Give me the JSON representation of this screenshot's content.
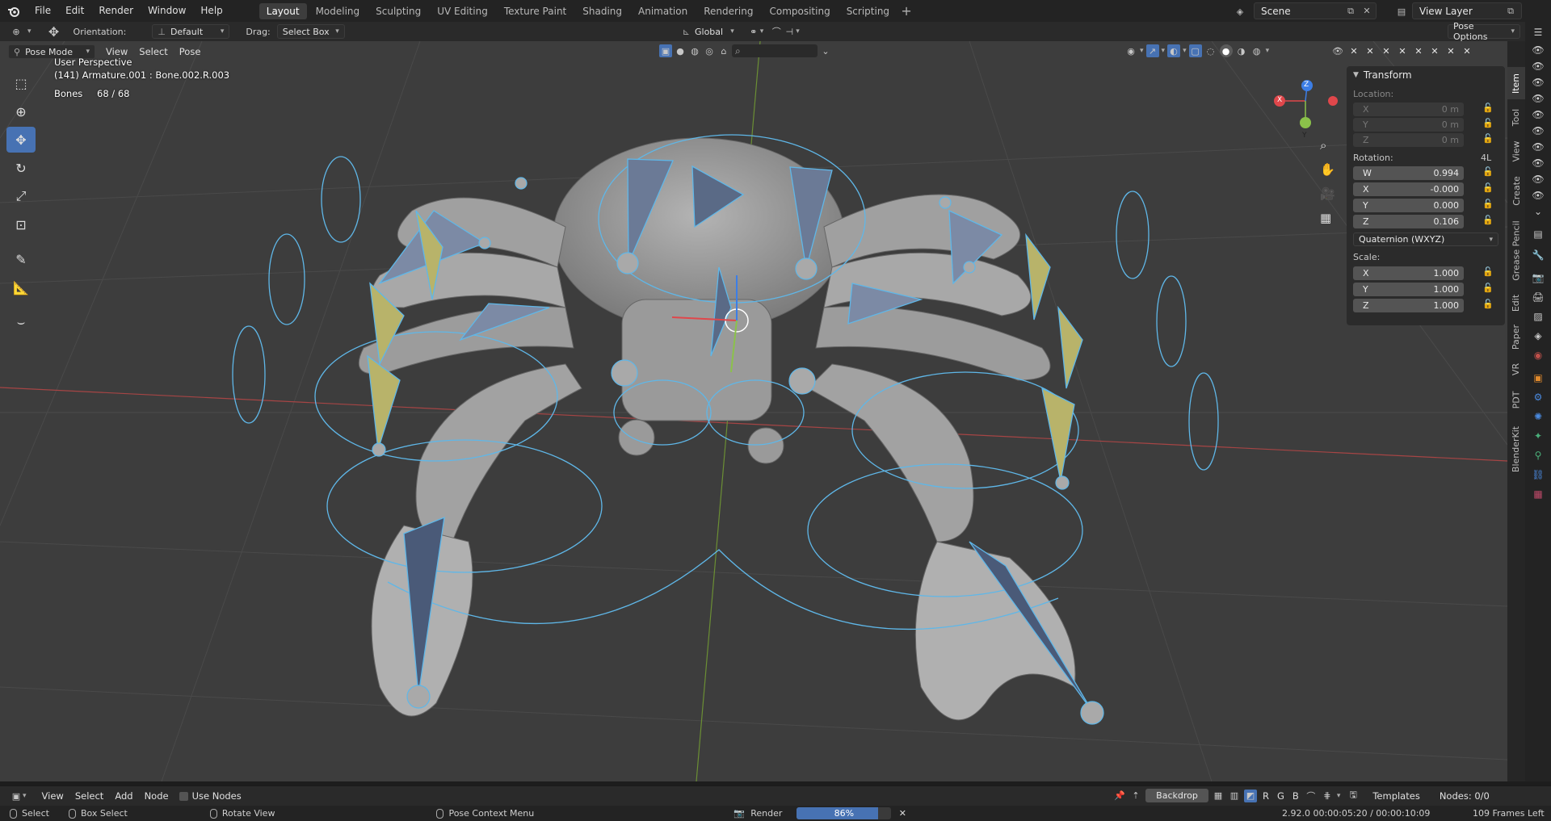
{
  "topbar": {
    "menus": [
      "File",
      "Edit",
      "Render",
      "Window",
      "Help"
    ],
    "workspaces": [
      "Layout",
      "Modeling",
      "Sculpting",
      "UV Editing",
      "Texture Paint",
      "Shading",
      "Animation",
      "Rendering",
      "Compositing",
      "Scripting"
    ],
    "active_workspace": "Layout",
    "scene": "Scene",
    "view_layer": "View Layer"
  },
  "header": {
    "orientation_label": "Orientation:",
    "orientation_value": "Default",
    "drag_label": "Drag:",
    "drag_value": "Select Box",
    "transform_orientation": "Global",
    "pose_options": "Pose Options"
  },
  "viewport": {
    "mode": "Pose Mode",
    "menus": [
      "View",
      "Select",
      "Pose"
    ],
    "perspective": "User Perspective",
    "active_object": "(141) Armature.001 : Bone.002.R.003",
    "bones_label": "Bones",
    "bones_value": "68 / 68",
    "gizmo_axes": [
      "X",
      "Y",
      "Z"
    ]
  },
  "transform_panel": {
    "title": "Transform",
    "location_label": "Location:",
    "location": [
      {
        "axis": "X",
        "value": "0 m"
      },
      {
        "axis": "Y",
        "value": "0 m"
      },
      {
        "axis": "Z",
        "value": "0 m"
      }
    ],
    "rotation_label": "Rotation:",
    "rotation_mode_tag": "4L",
    "rotation": [
      {
        "axis": "W",
        "value": "0.994"
      },
      {
        "axis": "X",
        "value": "-0.000"
      },
      {
        "axis": "Y",
        "value": "0.000"
      },
      {
        "axis": "Z",
        "value": "0.106"
      }
    ],
    "rotation_mode": "Quaternion (WXYZ)",
    "scale_label": "Scale:",
    "scale": [
      {
        "axis": "X",
        "value": "1.000"
      },
      {
        "axis": "Y",
        "value": "1.000"
      },
      {
        "axis": "Z",
        "value": "1.000"
      }
    ]
  },
  "side_tabs": [
    "Item",
    "Tool",
    "View",
    "Create",
    "Grease Pencil",
    "Edit",
    "Paper",
    "VR",
    "PDT",
    "BlenderKit"
  ],
  "node_editor": {
    "menus": [
      "View",
      "Select",
      "Add",
      "Node"
    ],
    "use_nodes": "Use Nodes",
    "backdrop": "Backdrop",
    "channels": [
      "R",
      "G",
      "B"
    ],
    "templates": "Templates",
    "nodes_count": "Nodes: 0/0"
  },
  "statusbar": {
    "select": "Select",
    "box_select": "Box Select",
    "rotate_view": "Rotate View",
    "context_menu": "Pose Context Menu",
    "render_label": "Render",
    "render_progress": 86,
    "render_progress_text": "86%",
    "version_time": "2.92.0  00:00:05:20 / 00:00:10:09",
    "frames_left": "109 Frames Left"
  },
  "colors": {
    "accent": "#4772b3",
    "bone_outline": "#5fb7e8",
    "axis_x": "#e0474b",
    "axis_y": "#8bc24a",
    "axis_z": "#3c7ee6"
  }
}
